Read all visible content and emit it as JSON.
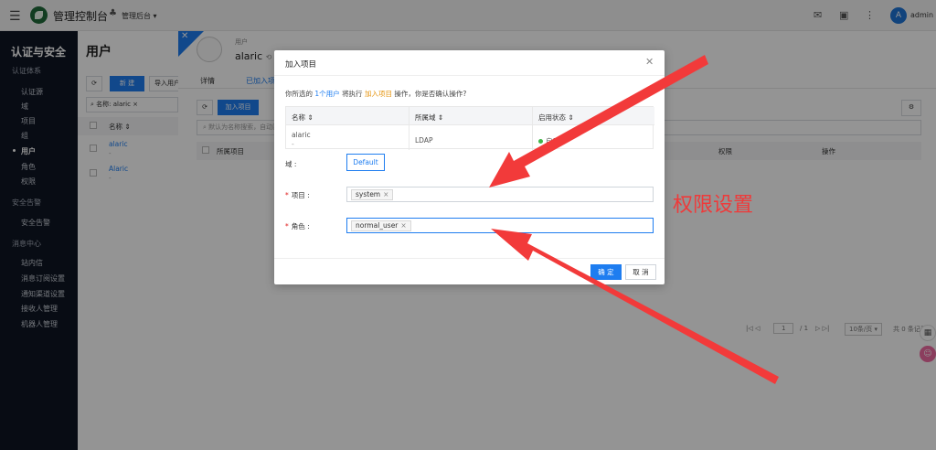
{
  "topbar": {
    "brand": "管理控制台",
    "scope": "管理后台",
    "avatar_initial": "A",
    "user": "admin"
  },
  "sidebar": {
    "title": "认证与安全",
    "group_auth": "认证体系",
    "items_auth": [
      "认证源",
      "域",
      "项目",
      "组",
      "用户",
      "角色",
      "权限"
    ],
    "active_index": 4,
    "group_alert": "安全告警",
    "items_alert": [
      "安全告警"
    ],
    "group_msg": "消息中心",
    "items_msg": [
      "站内信",
      "消息订阅设置",
      "通知渠道设置",
      "接收人管理",
      "机器人管理"
    ]
  },
  "main": {
    "title": "用户",
    "new_button": "新 建",
    "import_button": "导入用户",
    "filter_tag": "名称: alaric",
    "col_name": "名称",
    "rows": [
      {
        "name": "alaric",
        "sub": "-"
      },
      {
        "name": "Alaric",
        "sub": "-"
      }
    ]
  },
  "drawer": {
    "subtitle": "用户",
    "name": "alaric",
    "tabs": [
      "详情",
      "已加入项目"
    ],
    "active_tab": 1,
    "add_button": "加入项目",
    "search_placeholder": "默认为名称搜索，自动匹配",
    "col_project": "所属项目",
    "col_perm": "权限",
    "col_op": "操作",
    "pager_page": "1",
    "pager_total_pages": "/ 1",
    "pager_size": "10条/页",
    "pager_total": "共 0 条记录"
  },
  "dialog": {
    "title": "加入项目",
    "confirm_prefix": "你所选的",
    "confirm_count": "1个用户",
    "confirm_mid": "将执行",
    "confirm_action": "加入项目",
    "confirm_suffix": "操作，你是否确认操作?",
    "table": {
      "headers": [
        "名称",
        "所属域",
        "启用状态"
      ],
      "row": {
        "name": "alaric",
        "sub": "-",
        "domain": "LDAP",
        "status": "启用"
      }
    },
    "domain_label": "域",
    "domain_value": "Default",
    "project_label": "项目",
    "project_tag": "system",
    "role_label": "角色",
    "role_tag": "normal_user",
    "ok_button": "确 定",
    "cancel_button": "取 消"
  },
  "annotation": {
    "text": "权限设置",
    "color": "#ef3a3a"
  },
  "colors": {
    "primary": "#1e7df0",
    "sidebar_bg": "#0f1624",
    "status_green": "#3fb548",
    "required_red": "#e02020"
  }
}
